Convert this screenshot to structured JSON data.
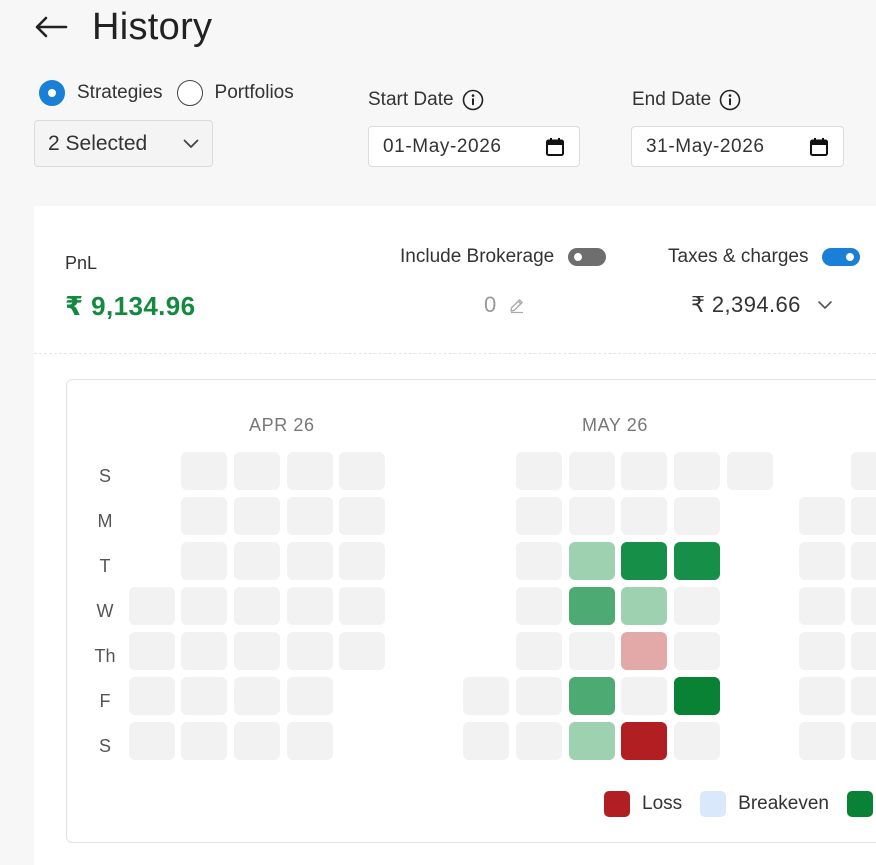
{
  "header": {
    "title": "History",
    "back_icon": "back-arrow-icon"
  },
  "filters": {
    "radio_options": [
      {
        "label": "Strategies",
        "checked": true
      },
      {
        "label": "Portfolios",
        "checked": false
      }
    ],
    "select_value": "2 Selected",
    "start_date": {
      "label": "Start Date",
      "value": "01-May-2026"
    },
    "end_date": {
      "label": "End Date",
      "value": "31-May-2026"
    }
  },
  "summary": {
    "pnl_label": "PnL",
    "pnl_value": "₹ 9,134.96",
    "brokerage_label": "Include Brokerage",
    "brokerage_toggle": "off",
    "brokerage_value": "0",
    "taxes_label": "Taxes & charges",
    "taxes_toggle": "on",
    "taxes_value": "₹ 2,394.66"
  },
  "heatmap": {
    "months": [
      "APR 26",
      "MAY 26"
    ],
    "days": [
      "S",
      "M",
      "T",
      "W",
      "Th",
      "F",
      "S"
    ],
    "colors": {
      "empty": "#f2f2f2",
      "profit_light": "#9dd1af",
      "profit_medium": "#4caa72",
      "profit_strong": "#168f49",
      "profit_darkest": "#0a8236",
      "loss_light": "#e3a8a8",
      "loss_strong": "#b11f23"
    },
    "legend": [
      {
        "label": "Loss",
        "color": "#b11f23"
      },
      {
        "label": "Breakeven",
        "color": "#d9e8fa"
      },
      {
        "label": "",
        "color": "#0a8236"
      }
    ]
  }
}
